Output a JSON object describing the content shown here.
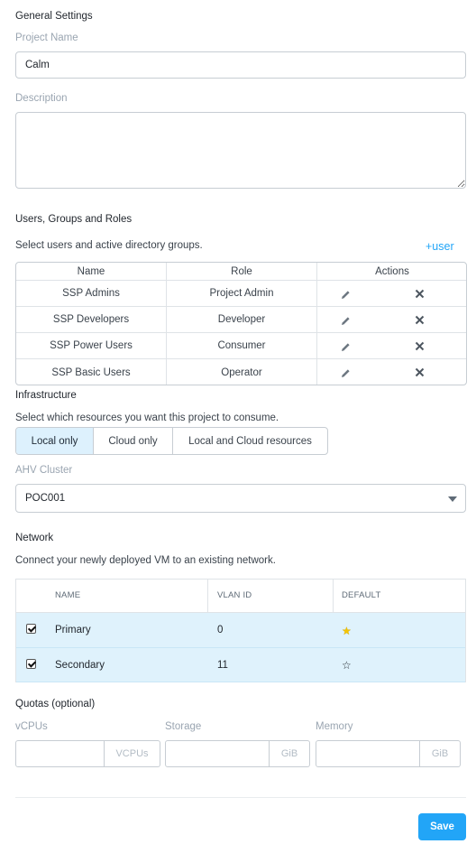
{
  "general": {
    "title": "General Settings",
    "project_name_label": "Project Name",
    "project_name_value": "Calm",
    "description_label": "Description",
    "description_value": ""
  },
  "users": {
    "title": "Users, Groups and Roles",
    "help": "Select users and active directory groups.",
    "add_link": "+user",
    "columns": [
      "Name",
      "Role",
      "Actions"
    ],
    "rows": [
      {
        "name": "SSP Admins",
        "role": "Project Admin"
      },
      {
        "name": "SSP Developers",
        "role": "Developer"
      },
      {
        "name": "SSP Power Users",
        "role": "Consumer"
      },
      {
        "name": "SSP Basic Users",
        "role": "Operator"
      }
    ],
    "edit_icon": "pencil-icon",
    "delete_icon": "close-icon"
  },
  "infrastructure": {
    "title": "Infrastructure",
    "help": "Select which resources you want this project to consume.",
    "options": [
      "Local only",
      "Cloud only",
      "Local and Cloud resources"
    ],
    "selected": "Local only",
    "cluster_label": "AHV Cluster",
    "cluster_value": "POC001"
  },
  "network": {
    "title": "Network",
    "help": "Connect your newly deployed VM to an existing network.",
    "columns": [
      "NAME",
      "VLAN ID",
      "DEFAULT"
    ],
    "rows": [
      {
        "name": "Primary",
        "vlan": "0",
        "checked": true,
        "default": true
      },
      {
        "name": "Secondary",
        "vlan": "11",
        "checked": true,
        "default": false
      }
    ],
    "star_color_default": "#f5c400"
  },
  "quotas": {
    "title": "Quotas (optional)",
    "fields": [
      {
        "label": "vCPUs",
        "unit": "VCPUs",
        "value": ""
      },
      {
        "label": "Storage",
        "unit": "GiB",
        "value": ""
      },
      {
        "label": "Memory",
        "unit": "GiB",
        "value": ""
      }
    ]
  },
  "footer": {
    "save_label": "Save"
  },
  "colors": {
    "accent": "#22a5f7",
    "selected_bg": "#ddf1fd"
  }
}
